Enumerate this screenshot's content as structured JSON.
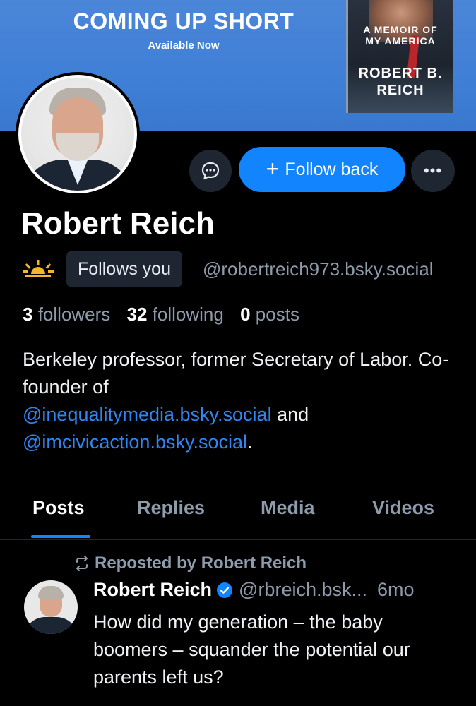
{
  "banner": {
    "title": "COMING UP SHORT",
    "subtitle": "Available Now",
    "book_line1": "A MEMOIR OF",
    "book_line2": "MY AMERICA",
    "book_author1": "ROBERT B.",
    "book_author2": "REICH"
  },
  "actions": {
    "follow_label": "Follow back",
    "follow_icon": "plus-icon",
    "message_icon": "chat-bubble-icon",
    "more_icon": "ellipsis-icon"
  },
  "profile": {
    "display_name": "Robert Reich",
    "follows_you_label": "Follows you",
    "handle": "@robertreich973.bsky.social",
    "status_icon": "sun-icon"
  },
  "stats": {
    "followers_count": "3",
    "followers_label": "followers",
    "following_count": "32",
    "following_label": "following",
    "posts_count": "0",
    "posts_label": "posts"
  },
  "bio": {
    "text1": "Berkeley professor, former Secretary of Labor. Co-founder of",
    "link1": "@inequalitymedia.bsky.social",
    "text2": "and",
    "link2": "@imcivicaction.bsky.social",
    "text3": "."
  },
  "tabs": [
    "Posts",
    "Replies",
    "Media",
    "Videos"
  ],
  "active_tab": "Posts",
  "post": {
    "repost_label": "Reposted by Robert Reich",
    "author_name": "Robert Reich",
    "author_handle": "@rbreich.bsk...",
    "time": "6mo",
    "text": "How did my generation – the baby boomers – squander the potential our parents left us?"
  },
  "colors": {
    "accent": "#1184fe",
    "link": "#2f86f0",
    "muted_text": "#8e9bab",
    "background": "#000000",
    "button_bg": "#1e2631",
    "banner": "#3f7fd6"
  }
}
